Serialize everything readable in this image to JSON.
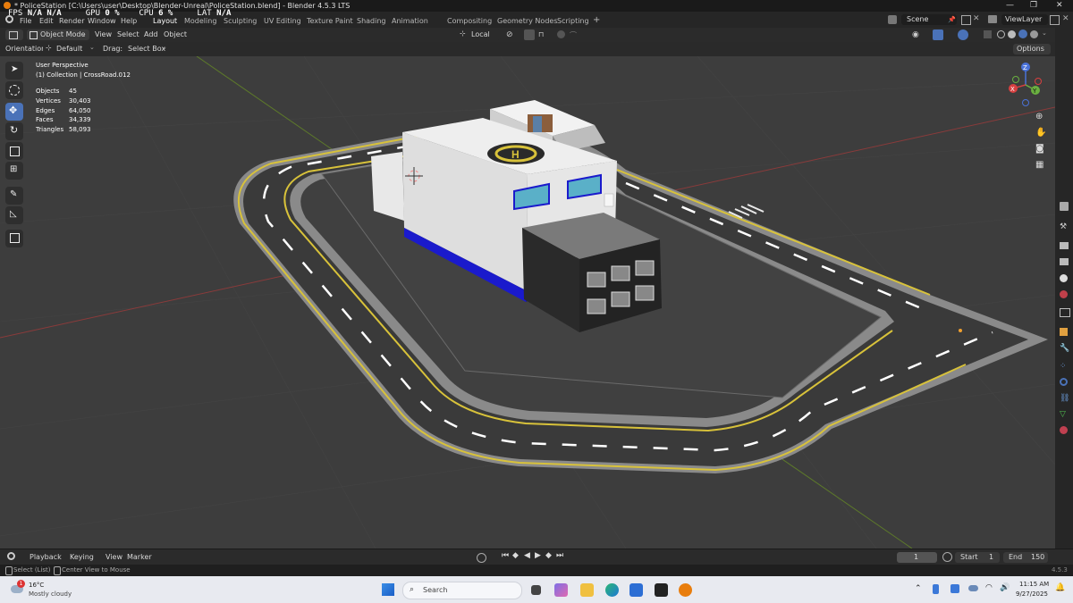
{
  "window": {
    "title": "* PoliceStation [C:\\Users\\user\\Desktop\\Blender-Unreal\\PoliceStation.blend] - Blender 4.5.3 LTS",
    "minimize": "—",
    "maximize": "❐",
    "close": "✕"
  },
  "perf_overlay": {
    "fps_label": "FPS",
    "fps_value": "N/A",
    "gpu_label": "GPU",
    "gpu_value": "0 %",
    "cpu_label": "CPU",
    "cpu_value": "6 %",
    "lat_label": "LAT",
    "lat_value": "N/A",
    "extra": "N/A"
  },
  "menu": {
    "items": [
      "File",
      "Edit",
      "Render",
      "Window",
      "Help"
    ],
    "workspaces": [
      "Layout",
      "Modeling",
      "Sculpting",
      "UV Editing",
      "Texture Paint",
      "Shading",
      "Animation",
      "Compositing",
      "Geometry Nodes",
      "Scripting"
    ],
    "active_workspace": "Layout",
    "add_tab": "+",
    "scene": "Scene",
    "view_layer": "ViewLayer"
  },
  "header": {
    "mode": "Object Mode",
    "view": "View",
    "select": "Select",
    "add": "Add",
    "object": "Object",
    "transform_space": "Local"
  },
  "toolrow": {
    "orientation_label": "Orientation:",
    "orientation_value": "Default",
    "drag_label": "Drag:",
    "drag_value": "Select Box",
    "options": "Options"
  },
  "viewport_info": {
    "perspective": "User Perspective",
    "collection": "(1) Collection | CrossRoad.012",
    "stats": [
      {
        "label": "Objects",
        "value": "45"
      },
      {
        "label": "Vertices",
        "value": "30,403"
      },
      {
        "label": "Edges",
        "value": "64,050"
      },
      {
        "label": "Faces",
        "value": "34,339"
      },
      {
        "label": "Triangles",
        "value": "58,093"
      }
    ],
    "helipad_letter": "H"
  },
  "gizmo": {
    "x": "X",
    "y": "Y",
    "z": "Z"
  },
  "timeline": {
    "playback": "Playback",
    "keying": "Keying",
    "view": "View",
    "marker": "Marker",
    "current_frame": "1",
    "start_label": "Start",
    "start_value": "1",
    "end_label": "End",
    "end_value": "150"
  },
  "status": {
    "select": "Select (List)",
    "center": "Center View to Mouse",
    "version": "4.5.3"
  },
  "taskbar": {
    "weather_temp": "16°C",
    "weather_desc": "Mostly cloudy",
    "notification_count": "1",
    "search_placeholder": "Search",
    "time": "11:15 AM",
    "date": "9/27/2025"
  },
  "colors": {
    "accent": "#4a72b8",
    "viewport_bg": "#3d3d3d",
    "road": "#3a3a3a",
    "road_edge": "#8a8a8a",
    "yellow_line": "#d8c23a",
    "building": "#d9d9d9",
    "blue_trim": "#1a1acc"
  }
}
